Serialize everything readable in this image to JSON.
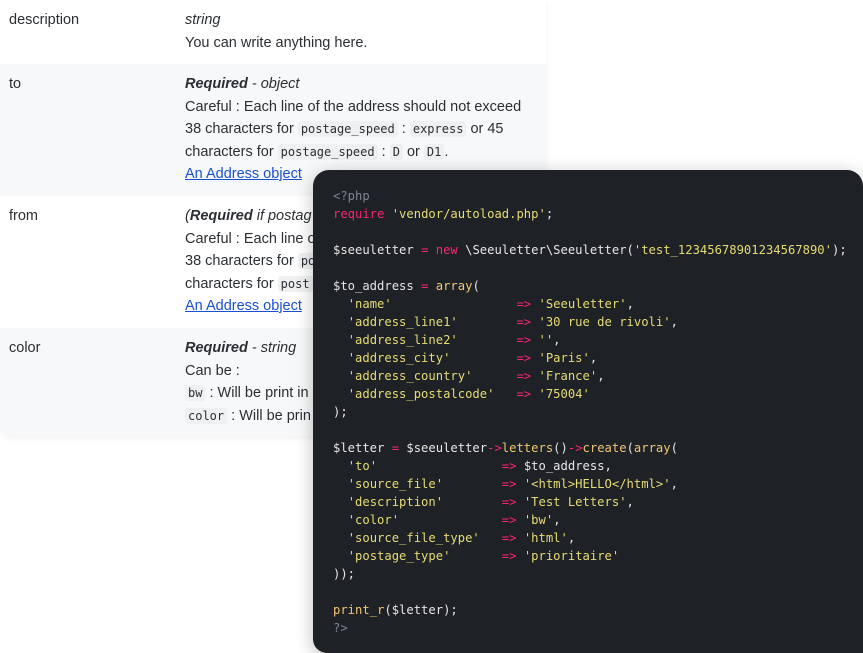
{
  "docs": {
    "rows": [
      {
        "name": "description",
        "type_plain": "string",
        "text": "You can write anything here."
      },
      {
        "name": "to",
        "type_req": "Required",
        "type_rest": " - object",
        "careful_pre": "Careful : Each line of the address should not exceed 38 characters for ",
        "code1": "postage_speed",
        "sep1": " : ",
        "code2": "express",
        "mid": " or 45 characters for ",
        "code3": "postage_speed",
        "sep2": " : ",
        "code4": "D",
        "or": " or ",
        "code5": "D1",
        "end": ".",
        "link": "An Address object"
      },
      {
        "name": "from",
        "type_open": "(",
        "type_req": "Required",
        "type_rest": " if postag",
        "line1": "Careful : Each line o",
        "line2_pre": "38 characters for ",
        "line2_code": "po",
        "line3_pre": "characters for ",
        "line3_code": "post",
        "link": "An Address object"
      },
      {
        "name": "color",
        "type_req": "Required",
        "type_rest": " - string",
        "can_be": "Can be :",
        "opt1_code": "bw",
        "opt1_text": " : Will be print in",
        "opt2_code": "color",
        "opt2_text": " : Will be prin"
      }
    ]
  },
  "code": {
    "language": "php",
    "open_tag": "<?php",
    "close_tag": "?>",
    "require_kw": "require",
    "require_path": "'vendor/autoload.php'",
    "api_key": "'test_12345678901234567890'",
    "address": [
      {
        "key": "'name'",
        "value": "'Seeuletter'"
      },
      {
        "key": "'address_line1'",
        "value": "'30 rue de rivoli'"
      },
      {
        "key": "'address_line2'",
        "value": "''"
      },
      {
        "key": "'address_city'",
        "value": "'Paris'"
      },
      {
        "key": "'address_country'",
        "value": "'France'"
      },
      {
        "key": "'address_postalcode'",
        "value": "'75004'"
      }
    ],
    "letter": [
      {
        "key": "'to'",
        "value": "$to_address"
      },
      {
        "key": "'source_file'",
        "value": "'<html>HELLO</html>'"
      },
      {
        "key": "'description'",
        "value": "'Test Letters'"
      },
      {
        "key": "'color'",
        "value": "'bw'"
      },
      {
        "key": "'source_file_type'",
        "value": "'html'"
      },
      {
        "key": "'postage_type'",
        "value": "'prioritaire'"
      }
    ],
    "print_fn": "print_r",
    "print_arg": "($letter);"
  }
}
